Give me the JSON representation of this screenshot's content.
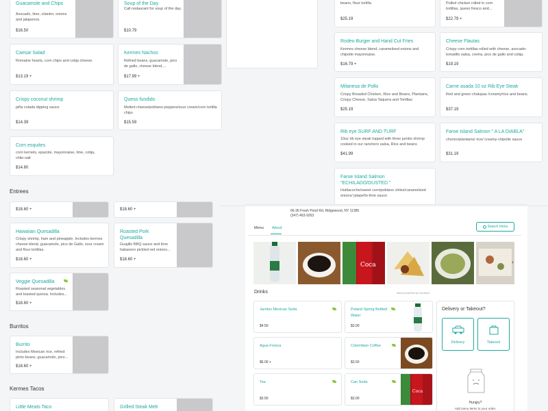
{
  "top_cards": {
    "guac": {
      "title": "Guacamole and Chips",
      "desc": "Avocado, lime, cilantro, onions and jalapenos.",
      "price": "$16.50"
    },
    "soup": {
      "title": "Soup of the Day",
      "desc": "Call restaurant for soup of the day.",
      "price": "$10.79"
    },
    "caesar": {
      "title": "Caesar Salad",
      "desc": "Romaine hearts, corn chips and cotija cheese.",
      "price": "$13.19 +"
    },
    "nachos": {
      "title": "Kermes Nachos",
      "desc": "Refried beans, guacamole, pico de gallo, cheese blend,...",
      "price": "$17.99 +"
    },
    "shrimp": {
      "title": "Crispy coconut shrimp",
      "desc": "piña colada dipping sauce",
      "price": "$14.39"
    },
    "fundido": {
      "title": "Queso fundido",
      "desc": "Melted cheese/poblano peppers/sour cream/corn tortilla chips",
      "price": "$15.59"
    },
    "esquites": {
      "title": "Corn esquites",
      "desc": "corn kernels, epazote, mayonnaise, lime, cotija, chile-salt",
      "price": "$14.80"
    }
  },
  "right_cards": {
    "flour": {
      "desc": "beans, flour tortilla",
      "price": "$25.19"
    },
    "pulled": {
      "desc": "Pulled chicken rolled in corn tortillas, queso fresco and...",
      "price": "$22.79 +"
    },
    "rodeo": {
      "title": "Rodeo Burger and Hand Cut Fries",
      "desc": "Kermes cheese blend, caramelized onions and chipotle mayonnaise.",
      "price": "$16.79 +"
    },
    "flautas": {
      "title": "Cheese Flautas",
      "desc": "Crispy corn tortillas rolled with cheese, avocado-tomatillo salsa, crema, pico de gallo and cotija.",
      "price": "$19.19"
    },
    "milanesa": {
      "title": "Milanesa de Pollo",
      "desc": "Crispy Breaded Chicken, Rice and Beans, Plantains, Crispy Cheese, Salsa Taquera and Tortillas",
      "price": "$25.19"
    },
    "asada": {
      "title": "Carne asada 10 oz Rib Eye Steak",
      "desc": "Red and green chalupas /creamy/rice and beans.",
      "price": "$37.19"
    },
    "surf": {
      "title": "Rib eye SURF AND TURF",
      "desc": "10oz rib eye steak topped with three jumbo shrimp cooked in our ranchero salsa, Rice and beans",
      "price": "$41.99"
    },
    "diabla": {
      "title": "Faroe Island Salmon \" A LA DIABLA\"",
      "desc": "chorizo/plantains/ rice/ creamy-chipotle sauce",
      "price": "$31.19"
    },
    "dusted": {
      "title": "Faroe Island Salmon \"ECHILADO/DUSTED \"",
      "desc": "Huitlacoche/sweet corn/poblano chiles/caramelized onions/ jalapeño-lime sauce"
    }
  },
  "sections": {
    "entrees": "Entrees",
    "burritos": "Burritos",
    "tacos": "Kermes Tacos"
  },
  "entrees": {
    "p1": "$18.60 +",
    "p2": "$18.60 +",
    "hawaiian": {
      "title": "Hawaiian Quesadilla",
      "desc": "Crispy shrimp, ham and pineapple. Includes kermes cheese blend, guacamole, pico de Gallo, sour cream and flour tortillas.",
      "price": "$18.60 +"
    },
    "pork": {
      "title": "Roasted Pork Quesadilla",
      "desc": "Guajillo BBQ sauce and lime habanero pickled red onions...",
      "price": "$18.60 +"
    },
    "veggie": {
      "title": "Veggie Quesadilla",
      "desc": "Roasted seasonal vegetables and toasted quinoa. Includes...",
      "price": "$18.60 +"
    }
  },
  "burrito": {
    "title": "Burrito",
    "desc": "Includes Mexican rice, refried pinto beans, guacamole, pico...",
    "price": "$18.60 +"
  },
  "tacos": {
    "little": "Little Meats Taco",
    "steak": "Grilled Steak Melt"
  },
  "overlay": {
    "address": "66-36 Fresh Pond Rd, Ridgewood, NY 11385",
    "phone": "(347) 463-9263",
    "tab_menu": "Menu",
    "tab_about": "About",
    "search_label": "Search menu",
    "drinks_heading": "Drinks",
    "powered": "Menu powered by Grubhub",
    "drinks": [
      {
        "name": "Jarritos Mexican Soda",
        "price": "$4.50"
      },
      {
        "name": "Poland Spring Bottled Water",
        "price": "$3.00"
      },
      {
        "name": "Agua Fresca",
        "price": "$6.00 +"
      },
      {
        "name": "Colombian Coffee",
        "price": "$3.50"
      },
      {
        "name": "Tea",
        "price": "$3.50"
      },
      {
        "name": "Can Soda",
        "price": "$3.00"
      }
    ],
    "order": {
      "title": "Delivery or Takeout?",
      "delivery": "Delivery",
      "takeout": "Takeout",
      "hungry": "Hungry?",
      "add": "Add menu items to your order."
    }
  },
  "colors": {
    "accent": "#1ba8a0",
    "leaf": "#8dc63f"
  }
}
